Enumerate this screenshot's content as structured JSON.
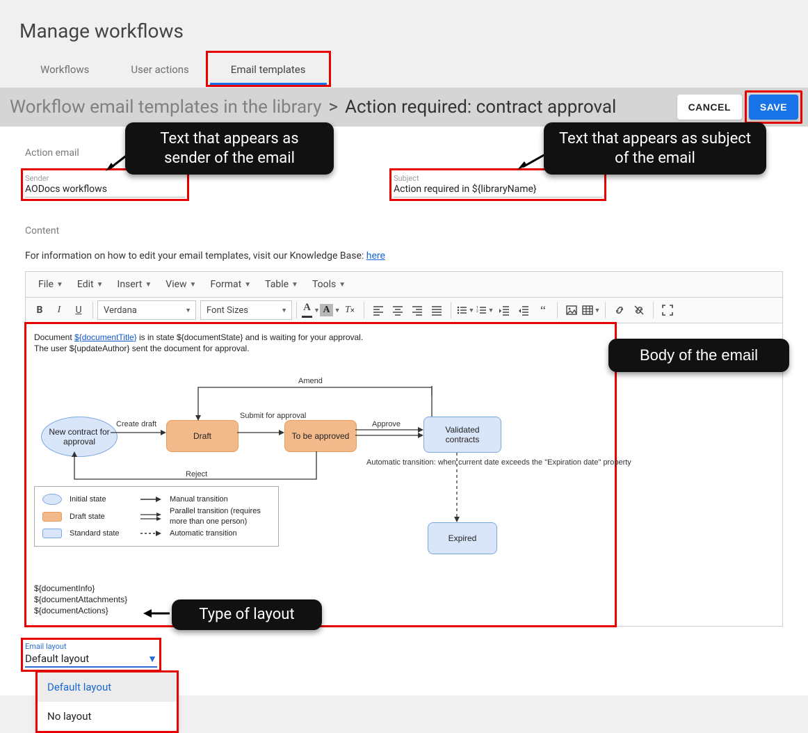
{
  "page": {
    "title": "Manage workflows"
  },
  "tabs": {
    "workflows": "Workflows",
    "user_actions": "User actions",
    "email_templates": "Email templates",
    "active": "email_templates"
  },
  "breadcrumb": {
    "root": "Workflow email templates in the library",
    "sep": ">",
    "current": "Action required: contract approval"
  },
  "actions": {
    "cancel": "CANCEL",
    "save": "SAVE"
  },
  "section_action_email": {
    "heading": "Action email",
    "sender_label": "Sender",
    "sender_value": "AODocs workflows",
    "subject_label": "Subject",
    "subject_value": "Action required in ${libraryName}"
  },
  "callouts": {
    "sender": "Text that appears as sender of the email",
    "subject": "Text that appears as subject of the email",
    "body": "Body of the email",
    "layout": "Type of layout"
  },
  "content": {
    "heading": "Content",
    "help_prefix": "For information on how to edit your email templates, visit our Knowledge Base: ",
    "help_link": "here"
  },
  "editor": {
    "menus": {
      "file": "File",
      "edit": "Edit",
      "insert": "Insert",
      "view": "View",
      "format": "Format",
      "table": "Table",
      "tools": "Tools"
    },
    "toolbar": {
      "font_family": "Verdana",
      "font_size": "Font Sizes"
    },
    "body": {
      "line1_prefix": "Document ",
      "line1_link": "${documentTitle}",
      "line1_suffix": " is in state ${documentState} and is waiting for your approval.",
      "line2": "The user ${updateAuthor} sent the document for approval."
    },
    "vars": {
      "v1": "${documentInfo}",
      "v2": "${documentAttachments}",
      "v3": "${documentActions}"
    }
  },
  "diagram": {
    "new_contract": "New contract for approval",
    "draft": "Draft",
    "to_be_approved": "To be approved",
    "validated": "Validated contracts",
    "expired": "Expired",
    "create_draft": "Create draft",
    "submit": "Submit for approval",
    "approve": "Approve",
    "amend": "Amend",
    "reject": "Reject",
    "auto_note": "Automatic transition: when current date exceeds the \"Expiration date\" property"
  },
  "legend": {
    "initial": "Initial state",
    "draft": "Draft state",
    "standard": "Standard state",
    "manual": "Manual transition",
    "parallel": "Parallel transition (requires more than one person)",
    "automatic": "Automatic transition"
  },
  "layout": {
    "label": "Email layout",
    "value": "Default layout",
    "options": {
      "default": "Default layout",
      "none": "No layout"
    }
  }
}
